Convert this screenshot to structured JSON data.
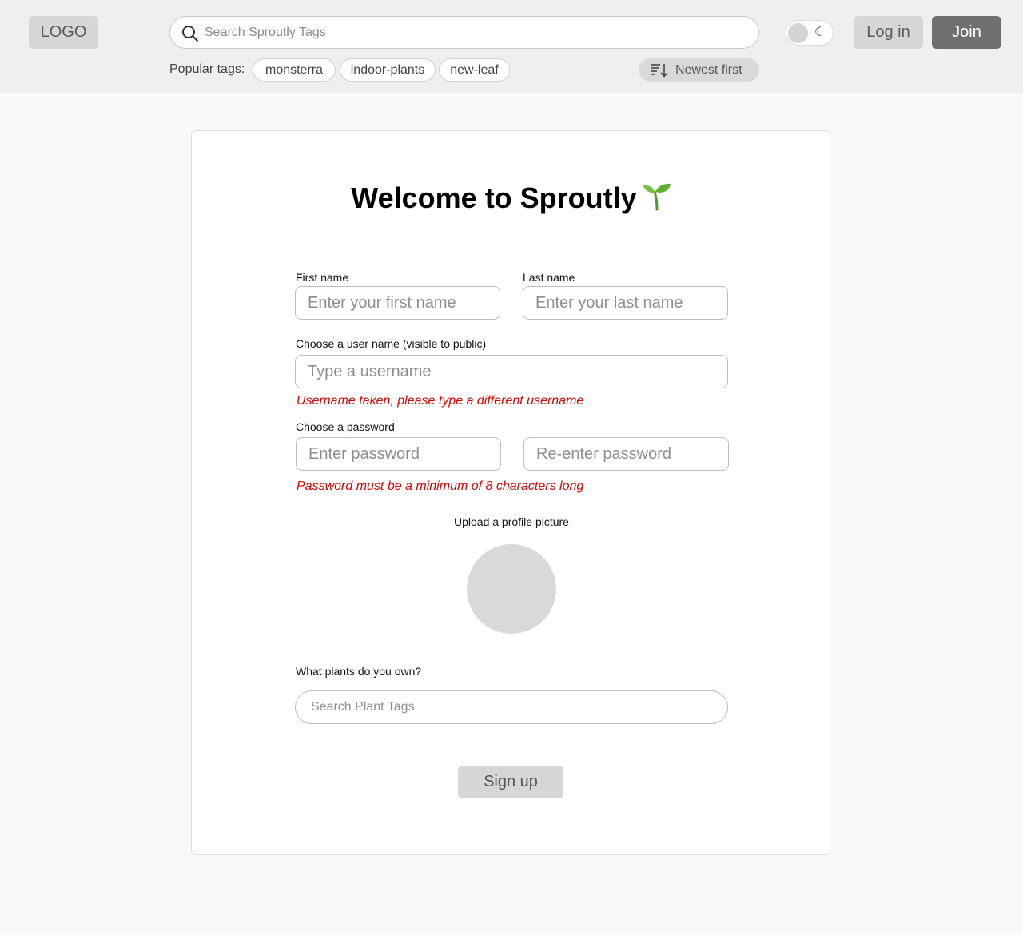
{
  "header": {
    "logo": "LOGO",
    "search_placeholder": "Search Sproutly Tags",
    "theme_toggle_icon": "☾",
    "login_label": "Log in",
    "join_label": "Join",
    "popular_label": "Popular tags:",
    "popular_tags": [
      "monsterra",
      "indoor-plants",
      "new-leaf"
    ],
    "sort_label": "Newest first"
  },
  "form": {
    "title": "Welcome to Sproutly",
    "first_name_label": "First name",
    "first_name_placeholder": "Enter your first name",
    "last_name_label": "Last name",
    "last_name_placeholder": "Enter your last name",
    "username_label": "Choose a user name (visible to public)",
    "username_placeholder": "Type a username",
    "username_error": "Username taken, please type a different username",
    "password_label": "Choose a password",
    "password_placeholder": "Enter password",
    "password_confirm_placeholder": "Re-enter password",
    "password_error": "Password must be a minimum of 8 characters long",
    "avatar_label": "Upload a profile picture",
    "plants_label": "What plants do you own?",
    "plants_placeholder": "Search Plant Tags",
    "signup_label": "Sign up"
  },
  "colors": {
    "error": "#e00000",
    "primary_button": "#6f6f6f",
    "secondary_button": "#d6d6d6"
  }
}
